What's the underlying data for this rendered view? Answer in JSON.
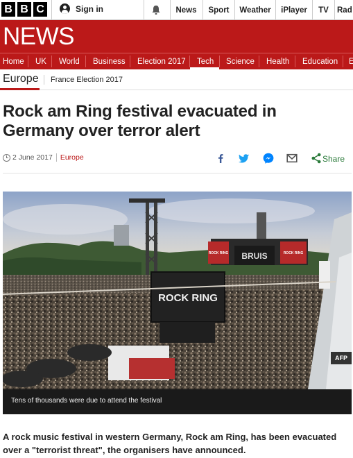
{
  "topbar": {
    "brand": [
      "B",
      "B",
      "C"
    ],
    "signin_label": "Sign in",
    "links": [
      "News",
      "Sport",
      "Weather",
      "iPlayer",
      "TV",
      "Rad"
    ]
  },
  "newsbar": {
    "title": "NEWS"
  },
  "sections": [
    "Home",
    "UK",
    "World",
    "Business",
    "Election 2017",
    "Tech",
    "Science",
    "Health",
    "Education",
    "E"
  ],
  "active_section": "Tech",
  "subnav": {
    "current": "Europe",
    "related": "France Election 2017"
  },
  "article": {
    "headline": "Rock am Ring festival evacuated in Germany over terror alert",
    "date": "2 June 2017",
    "section": "Europe",
    "share_label": "Share",
    "image": {
      "stage_sign": "ROCK RING",
      "stage_banner_left": "ROCK RING",
      "stage_banner_right": "ROCK RING",
      "stage_screen": "BRUIS",
      "credit": "AFP",
      "caption": "Tens of thousands were due to attend the festival"
    },
    "lede": "A rock music festival in western Germany, Rock am Ring, has been evacuated over a \"terrorist threat\", the organisers have announced."
  },
  "colors": {
    "brand_red": "#bb1919",
    "share_green": "#2a7a3a",
    "facebook": "#3b5998",
    "twitter": "#1da1f2",
    "messenger": "#0084ff"
  },
  "icons": [
    "user-icon",
    "bell-icon",
    "clock-icon",
    "facebook-icon",
    "twitter-icon",
    "messenger-icon",
    "email-icon",
    "share-icon"
  ]
}
